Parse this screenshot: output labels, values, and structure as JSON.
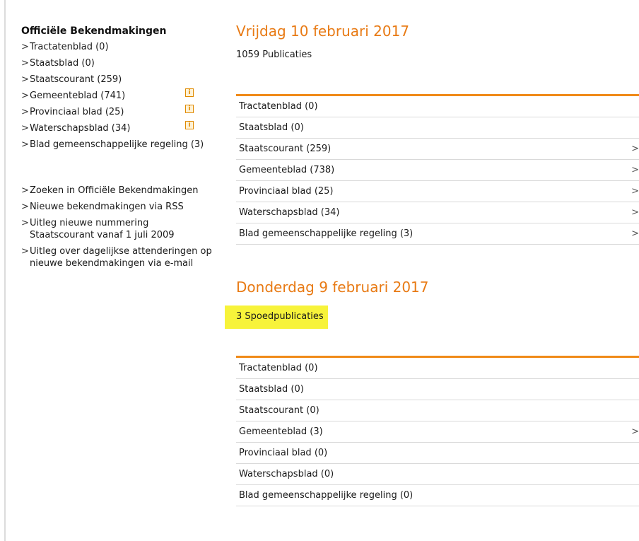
{
  "sidebar": {
    "title": "Officiële Bekendmakingen",
    "items": [
      {
        "label": "Tractatenblad (0)",
        "info": false
      },
      {
        "label": "Staatsblad (0)",
        "info": false
      },
      {
        "label": "Staatscourant (259)",
        "info": false
      },
      {
        "label": "Gemeenteblad (741)",
        "info": true
      },
      {
        "label": "Provinciaal blad (25)",
        "info": true
      },
      {
        "label": "Waterschapsblad (34)",
        "info": true
      },
      {
        "label": "Blad gemeenschappelijke regeling (3)",
        "info": false
      }
    ],
    "links": [
      {
        "label": "Zoeken in Officiële Bekendmakingen"
      },
      {
        "label": "Nieuwe bekendmakingen via RSS"
      },
      {
        "label": "Uitleg nieuwe nummering Staatscourant vanaf 1 juli 2009"
      },
      {
        "label": "Uitleg over dagelijkse attenderingen op nieuwe bekendmakingen via e-mail"
      }
    ],
    "chevron": ">",
    "info_glyph": "i"
  },
  "days": [
    {
      "title": "Vrijdag 10 februari 2017",
      "count": "1059 Publicaties",
      "rows": [
        {
          "label": "Tractatenblad (0)",
          "chevron": ""
        },
        {
          "label": "Staatsblad (0)",
          "chevron": ""
        },
        {
          "label": "Staatscourant (259)",
          "chevron": ">"
        },
        {
          "label": "Gemeenteblad (738)",
          "chevron": ">"
        },
        {
          "label": "Provinciaal blad (25)",
          "chevron": ">"
        },
        {
          "label": "Waterschapsblad (34)",
          "chevron": ">"
        },
        {
          "label": "Blad gemeenschappelijke regeling (3)",
          "chevron": ">"
        }
      ]
    },
    {
      "title": "Donderdag 9 februari 2017",
      "count": "3 Spoedpublicaties",
      "rows": [
        {
          "label": "Tractatenblad (0)",
          "chevron": ""
        },
        {
          "label": "Staatsblad (0)",
          "chevron": ""
        },
        {
          "label": "Staatscourant (0)",
          "chevron": ""
        },
        {
          "label": "Gemeenteblad (3)",
          "chevron": ">"
        },
        {
          "label": "Provinciaal blad (0)",
          "chevron": ""
        },
        {
          "label": "Waterschapsblad (0)",
          "chevron": ""
        },
        {
          "label": "Blad gemeenschappelijke regeling (0)",
          "chevron": ""
        }
      ]
    }
  ],
  "colors": {
    "accent_orange": "#f08a18",
    "title_orange": "#e87a14",
    "highlight_yellow": "#f7f33a"
  }
}
